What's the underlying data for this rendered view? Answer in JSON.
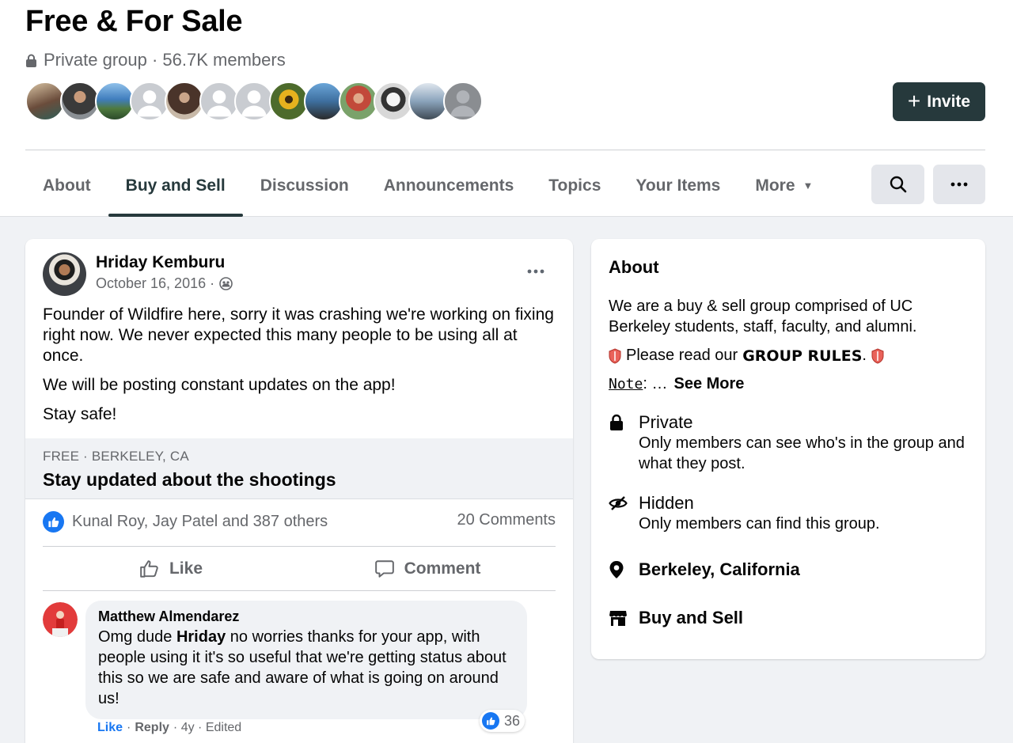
{
  "group": {
    "title": "Free & For Sale",
    "meta": "Private group · 56.7K members",
    "invite_label": "Invite"
  },
  "tabs": [
    {
      "label": "About"
    },
    {
      "label": "Buy and Sell"
    },
    {
      "label": "Discussion"
    },
    {
      "label": "Announcements"
    },
    {
      "label": "Topics"
    },
    {
      "label": "Your Items"
    },
    {
      "label": "More"
    }
  ],
  "post": {
    "author": "Hriday Kemburu",
    "date": "October 16, 2016 ·",
    "paragraphs": [
      "Founder of Wildfire here, sorry it was crashing we're working on fixing right now. We never expected this many people to be using all at once.",
      "We will be posting constant updates on the app!",
      "Stay safe!"
    ],
    "listing_meta": "FREE · BERKELEY, CA",
    "listing_title": "Stay updated about the shootings",
    "reactions_text": "Kunal Roy, Jay Patel and 387 others",
    "comments_count": "20 Comments",
    "like_label": "Like",
    "comment_label": "Comment"
  },
  "comment": {
    "author": "Matthew Almendarez",
    "text_before": "Omg dude ",
    "mention": "Hriday",
    "text_after": " no worries thanks for your app, with people using it it's so useful that we're getting status about this so we are safe and aware of what is going on around us!",
    "reaction_count": "36",
    "like": "Like",
    "dot1": "·",
    "reply": "Reply",
    "meta": "· 4y · Edited"
  },
  "about": {
    "title": "About",
    "description": "We are a buy & sell group comprised of UC Berkeley students, staff, faculty, and alumni.",
    "rules_prefix": "Please read our",
    "rules_bold": "GROUP RULES",
    "rules_suffix": ".",
    "note_label": "Note",
    "note_rest": ": …",
    "see_more": "See More",
    "items": [
      {
        "title": "Private",
        "sub": "Only members can see who's in the group and what they post."
      },
      {
        "title": "Hidden",
        "sub": "Only members can find this group."
      },
      {
        "title": "Berkeley, California"
      },
      {
        "title": "Buy and Sell"
      }
    ]
  },
  "colors": {
    "accent": "#26393c",
    "like_blue": "#1877f2",
    "secondary_text": "#65676b",
    "page_bg": "#f0f2f5"
  }
}
